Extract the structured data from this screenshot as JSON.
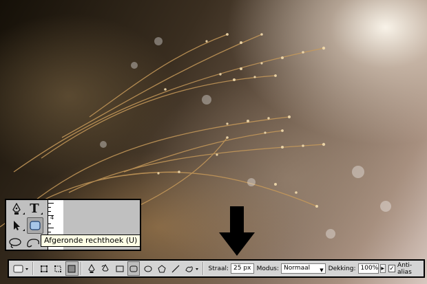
{
  "tools_panel": {
    "tools": [
      {
        "name": "pen-tool",
        "icon": "pen-icon"
      },
      {
        "name": "type-tool",
        "icon": "type-icon",
        "glyph": "T"
      },
      {
        "name": "path-selection-tool",
        "icon": "arrow-select-icon"
      },
      {
        "name": "rounded-rectangle-tool",
        "icon": "rounded-rectangle-icon",
        "active": true
      },
      {
        "name": "lasso-tool",
        "icon": "lasso-icon"
      },
      {
        "name": "magnetic-lasso-tool",
        "icon": "magnetic-lasso-icon"
      }
    ],
    "ruler_number": "4"
  },
  "tooltip": {
    "text": "Afgeronde rechthoek (U)"
  },
  "options_bar": {
    "straal_label": "Straal:",
    "straal_value": "25 px",
    "modus_label": "Modus:",
    "modus_value": "Normaal",
    "dekking_label": "Dekking:",
    "dekking_value": "100%",
    "antialias_label": "Anti-alias",
    "antialias_checked": true
  },
  "colors": {
    "panel_bg": "#c0c0c0",
    "options_bg": "#d4d4d4",
    "tooltip_bg": "#ffffe6",
    "active_tool_fill": "#a7c6e8"
  }
}
